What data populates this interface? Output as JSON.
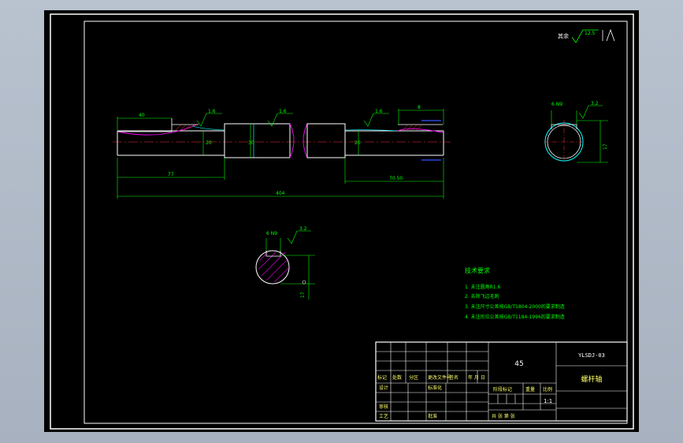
{
  "drawing": {
    "roughness_note": "其余",
    "roughness_value": "12.5",
    "dims": {
      "left_len": "40",
      "right_len": "8",
      "left_rough": "1.6",
      "center_rough": "1.6",
      "right_rough": "1.6",
      "d_left": "20",
      "d_center": "30",
      "d_right": "20",
      "left_span": "77",
      "right_span": "70.50",
      "total_len": "404"
    },
    "section_a": {
      "rough": "3.2",
      "key_width": "6 N9",
      "depth": "17"
    },
    "section_b": {
      "rough": "3.2",
      "key_width": "6 N9",
      "depth": "17"
    },
    "tech": {
      "title": "技术要求",
      "items": [
        "1. 未注圆角R1.6",
        "2. 去除飞边毛刺",
        "3. 未注尺寸公差按GB/T1804-2000的要求制造",
        "4. 未注形位公差按GB/T1184-1996的要求制造"
      ]
    },
    "title_block": {
      "material": "45",
      "drawing_no": "YLSDJ-03",
      "part_name": "螺杆轴",
      "scale": "1:1",
      "headers": {
        "mark": "标记",
        "count": "处数",
        "zone": "分区",
        "change_doc": "更改文件号",
        "sign": "签名",
        "date": "年 月 日",
        "design": "设计",
        "standardize": "标准化",
        "review": "审核",
        "process": "工艺",
        "approve": "批准",
        "stage_mark": "阶段标记",
        "weight": "重量",
        "ratio": "比例",
        "sheets": "共  张  第  张"
      }
    }
  }
}
